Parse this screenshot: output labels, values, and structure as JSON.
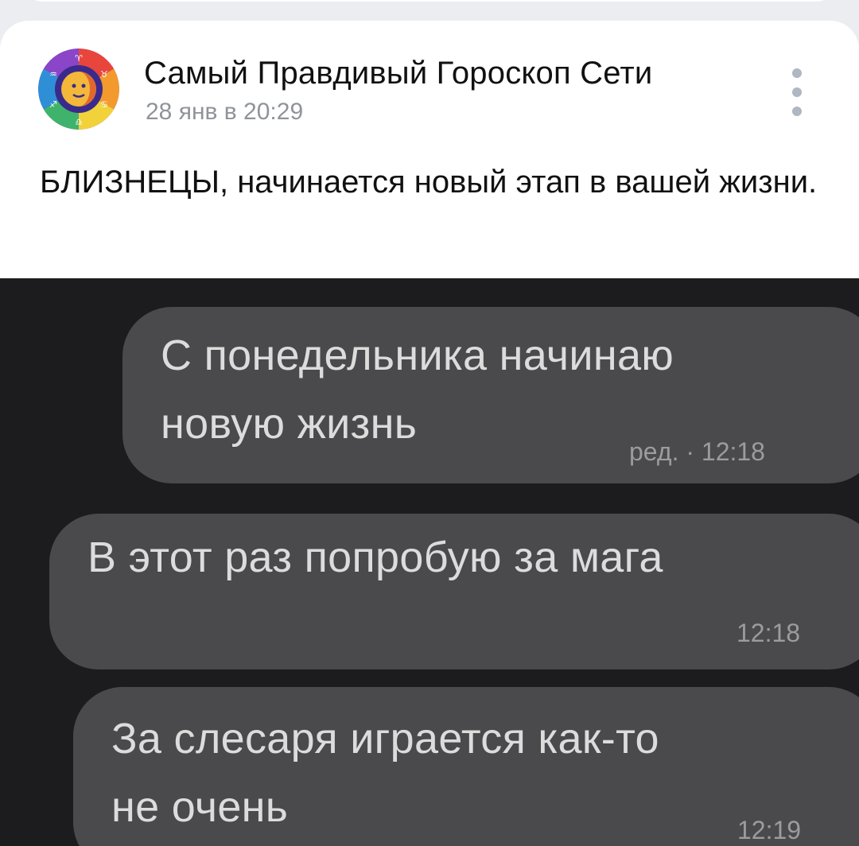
{
  "post": {
    "author": "Самый Правдивый Гороскоп Сети",
    "date": "28 янв в 20:29",
    "text": "БЛИЗНЕЦЫ, начинается новый этап в вашей жизни.",
    "avatar_icon": "zodiac-wheel-icon",
    "more_icon": "more-vertical-icon"
  },
  "image": {
    "messages": [
      {
        "lines": [
          "С понедельника начинаю",
          "новую жизнь"
        ],
        "meta": "ред. · 12:18"
      },
      {
        "lines": [
          "В этот раз попробую за мага"
        ],
        "meta": "12:18"
      },
      {
        "lines": [
          "За слесаря играется как-то",
          "не очень"
        ],
        "meta": "12:19"
      }
    ]
  },
  "colors": {
    "page_bg": "#ebedf0",
    "card_bg": "#ffffff",
    "chat_bg": "#1c1c1e",
    "bubble_bg": "#4a4a4c",
    "bubble_text": "#dcdcdc",
    "secondary_text": "#909499"
  }
}
